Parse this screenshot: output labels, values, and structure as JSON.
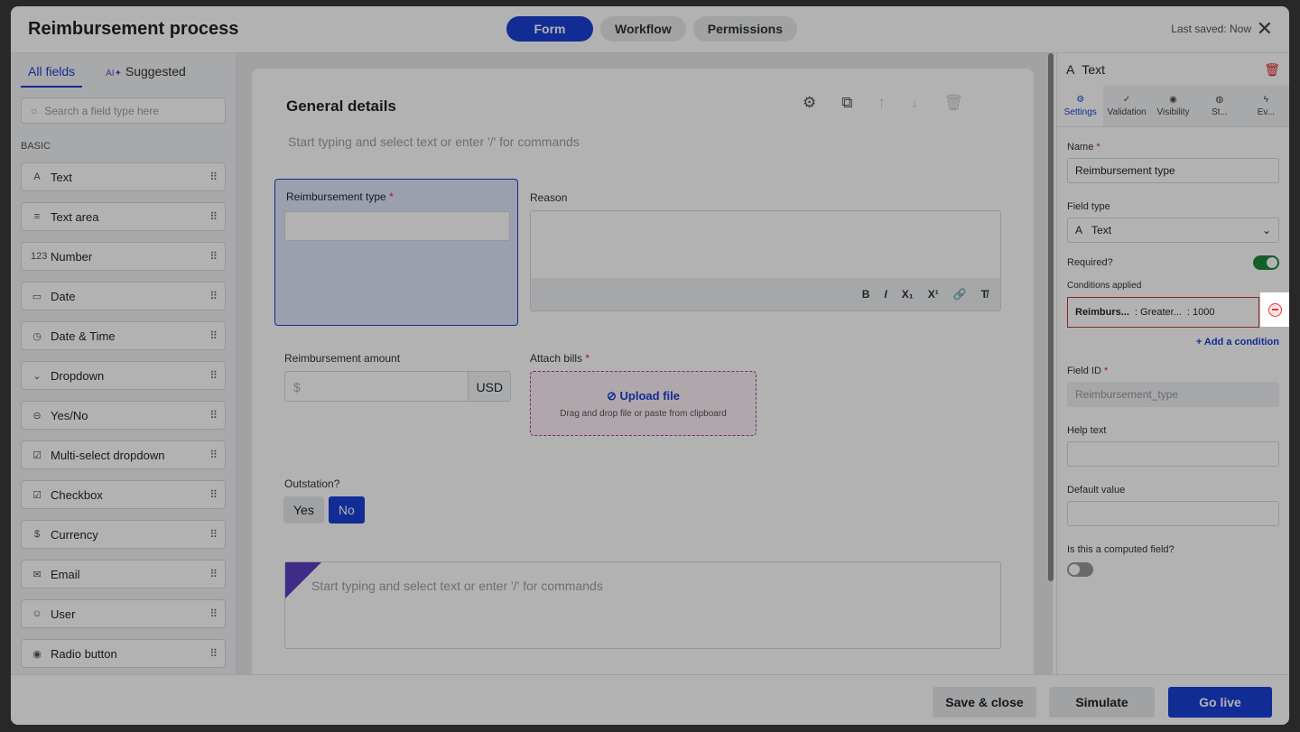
{
  "header": {
    "title": "Reimbursement process",
    "tabs": [
      "Form",
      "Workflow",
      "Permissions"
    ],
    "last_saved": "Last saved: Now"
  },
  "left": {
    "tabs": [
      "All fields",
      "Suggested"
    ],
    "search_placeholder": "Search a field type here",
    "section": "BASIC",
    "fields": [
      "Text",
      "Text area",
      "Number",
      "Date",
      "Date & Time",
      "Dropdown",
      "Yes/No",
      "Multi-select dropdown",
      "Checkbox",
      "Currency",
      "Email",
      "User",
      "Radio button"
    ]
  },
  "form": {
    "title": "General details",
    "subtitle": "Start typing and select text or enter '/' for commands",
    "reimb_type_label": "Reimbursement type",
    "reason_label": "Reason",
    "amount_label": "Reimbursement amount",
    "amount_prefix": "$",
    "currency": "USD",
    "attach_label": "Attach bills",
    "upload": "Upload file",
    "upload_hint": "Drag and drop file or paste from clipboard",
    "outstation_label": "Outstation?",
    "yes": "Yes",
    "no": "No",
    "rich_placeholder": "Start typing and select text or enter '/' for commands"
  },
  "right": {
    "title": "Text",
    "tabs": [
      "Settings",
      "Validation",
      "Visibility",
      "St...",
      "Ev..."
    ],
    "name_label": "Name",
    "name_value": "Reimbursement type",
    "field_type_label": "Field type",
    "field_type_value": "Text",
    "required_label": "Required?",
    "required": true,
    "conditions_label": "Conditions applied",
    "condition": {
      "field": "Reimburs...",
      "op": ": Greater...",
      "value": ": 1000"
    },
    "add_condition": "+ Add a condition",
    "field_id_label": "Field ID",
    "field_id_value": "Reimbursement_type",
    "help_label": "Help text",
    "default_label": "Default value",
    "computed_label": "Is this a computed field?",
    "computed": false
  },
  "footer": {
    "save_close": "Save & close",
    "simulate": "Simulate",
    "go_live": "Go live"
  }
}
